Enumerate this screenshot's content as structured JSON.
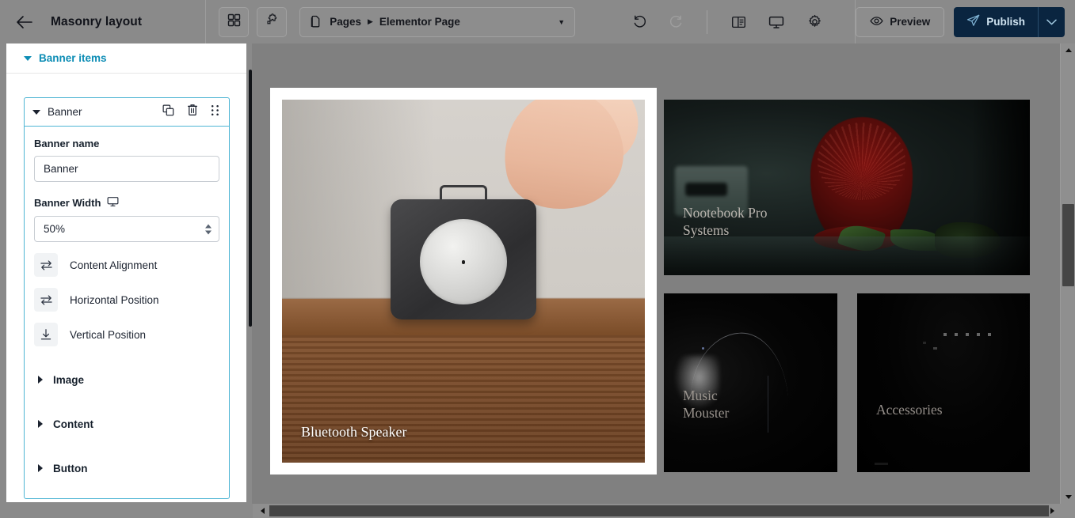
{
  "app": {
    "title": "Masonry layout"
  },
  "topbar": {
    "back_icon": "arrow-left-icon",
    "widgets_icon": "grid-widgets-icon",
    "addons_icon": "puzzle-addons-icon",
    "breadcrumb": {
      "doc_icon": "document-icon",
      "root": "Pages",
      "separator": "▶",
      "current": "Elementor Page",
      "caret": "▼"
    },
    "undo_icon": "undo-icon",
    "redo_icon": "redo-icon",
    "panel_icon": "layout-panel-icon",
    "responsive_icon": "desktop-monitor-icon",
    "settings_icon": "gear-icon",
    "preview_label": "Preview",
    "preview_icon": "eye-icon",
    "publish_label": "Publish",
    "publish_icon": "paper-plane-icon",
    "publish_caret": "⌄",
    "publish_color": "#0a2540",
    "bar_color": "#8a8a8a"
  },
  "sidebar": {
    "section": {
      "label": "Banner items",
      "color": "#0d8db5",
      "caret": "▼"
    },
    "item": {
      "title": "Banner",
      "caret": "▼",
      "duplicate_icon": "duplicate-icon",
      "delete_icon": "trash-icon",
      "drag_icon": "drag-handle-icon",
      "fields": [
        {
          "label": "Banner name",
          "value": "Banner",
          "type": "text"
        },
        {
          "label": "Banner Width",
          "value": "50%",
          "type": "number",
          "device_icon": "desktop-monitor-icon"
        }
      ],
      "controls": [
        {
          "label": "Content Alignment",
          "icon": "horizontal-swap-icon"
        },
        {
          "label": "Horizontal Position",
          "icon": "horizontal-swap-icon"
        },
        {
          "label": "Vertical Position",
          "icon": "arrow-down-line-icon"
        }
      ],
      "accordions": [
        {
          "label": "Image",
          "caret": "▶"
        },
        {
          "label": "Content",
          "caret": "▶"
        },
        {
          "label": "Button",
          "caret": "▶"
        }
      ]
    },
    "collapse_icon": "collapse-panel-arrow-icon"
  },
  "canvas": {
    "background": "#808080",
    "cards": [
      {
        "name": "bluetooth-speaker",
        "caption": "Bluetooth Speaker",
        "image_desc": "finger-touching-portable-bluetooth-speaker-on-wooden-table"
      },
      {
        "name": "nootebook-pro-systems",
        "caption": "Nootebook Pro\nSystems",
        "image_desc": "dark-red-fan-with-leaves-low-light"
      },
      {
        "name": "music-mouster",
        "caption": "Music\nMouster",
        "image_desc": "dark-computer-mouse-silhouette"
      },
      {
        "name": "accessories",
        "caption": "Accessories",
        "image_desc": "very-dark-accessories-product-shot"
      }
    ]
  },
  "scrollbars": {
    "vertical_up": "▲",
    "vertical_down": "▼",
    "horizontal_left": "◀",
    "horizontal_right": "▶"
  }
}
